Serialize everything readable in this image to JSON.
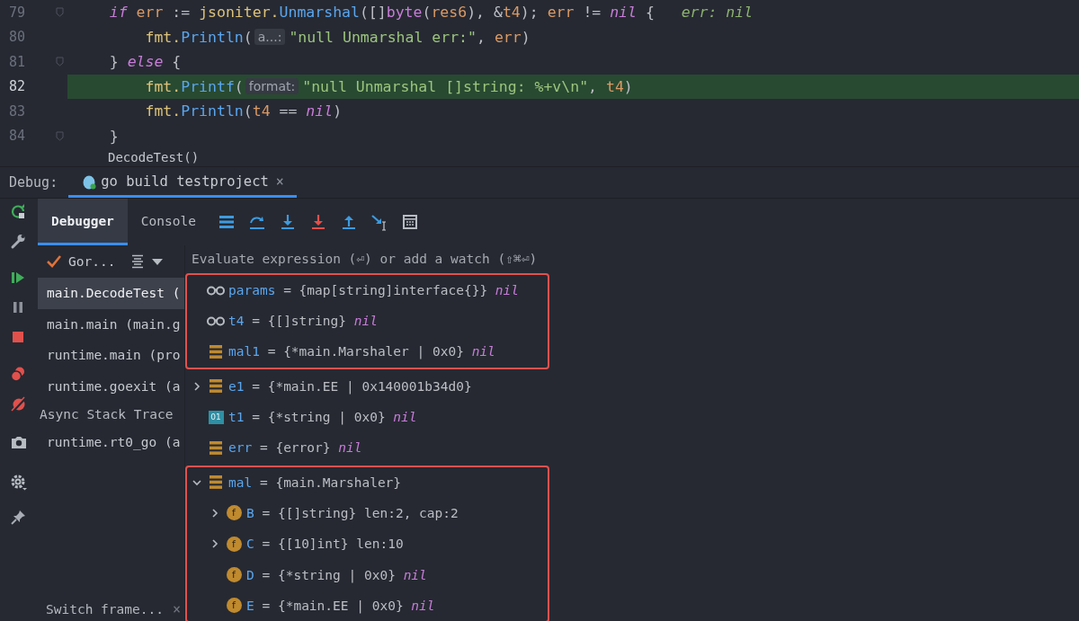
{
  "editor": {
    "lines": [
      {
        "number": "79",
        "current": false,
        "fold": true,
        "tokens": [
          {
            "kind": "kw",
            "text": "    if"
          },
          {
            "kind": "var",
            "text": " err"
          },
          {
            "kind": "plain",
            "text": " := "
          },
          {
            "kind": "pkg",
            "text": "jsoniter."
          },
          {
            "kind": "fn",
            "text": "Unmarshal"
          },
          {
            "kind": "plain",
            "text": "([]"
          },
          {
            "kind": "type",
            "text": "byte"
          },
          {
            "kind": "plain",
            "text": "("
          },
          {
            "kind": "var",
            "text": "res6"
          },
          {
            "kind": "plain",
            "text": "), &"
          },
          {
            "kind": "var",
            "text": "t4"
          },
          {
            "kind": "plain",
            "text": "); "
          },
          {
            "kind": "var",
            "text": "err"
          },
          {
            "kind": "plain",
            "text": " != "
          },
          {
            "kind": "kw",
            "text": "nil"
          },
          {
            "kind": "plain",
            "text": " {   "
          },
          {
            "kind": "hint",
            "text": "err: nil"
          }
        ]
      },
      {
        "number": "80",
        "current": false,
        "fold": false,
        "tokens": [
          {
            "kind": "pkg",
            "text": "        fmt."
          },
          {
            "kind": "fn",
            "text": "Println"
          },
          {
            "kind": "plain",
            "text": "("
          },
          {
            "kind": "inlay",
            "text": "a...:"
          },
          {
            "kind": "str",
            "text": "\"null Unmarshal err:\""
          },
          {
            "kind": "plain",
            "text": ", "
          },
          {
            "kind": "var",
            "text": "err"
          },
          {
            "kind": "plain",
            "text": ")"
          }
        ]
      },
      {
        "number": "81",
        "current": false,
        "fold": true,
        "tokens": [
          {
            "kind": "plain",
            "text": "    }"
          },
          {
            "kind": "kw",
            "text": " else"
          },
          {
            "kind": "plain",
            "text": " {"
          }
        ]
      },
      {
        "number": "82",
        "current": true,
        "fold": false,
        "tokens": [
          {
            "kind": "pkg",
            "text": "        fmt."
          },
          {
            "kind": "fn",
            "text": "Printf"
          },
          {
            "kind": "plain",
            "text": "("
          },
          {
            "kind": "inlay",
            "text": "format:"
          },
          {
            "kind": "str",
            "text": "\"null Unmarshal []string: %+v\\n\""
          },
          {
            "kind": "plain",
            "text": ", "
          },
          {
            "kind": "var",
            "text": "t4"
          },
          {
            "kind": "plain",
            "text": ")"
          }
        ]
      },
      {
        "number": "83",
        "current": false,
        "fold": false,
        "tokens": [
          {
            "kind": "pkg",
            "text": "        fmt."
          },
          {
            "kind": "fn",
            "text": "Println"
          },
          {
            "kind": "plain",
            "text": "("
          },
          {
            "kind": "var",
            "text": "t4"
          },
          {
            "kind": "plain",
            "text": " == "
          },
          {
            "kind": "kw",
            "text": "nil"
          },
          {
            "kind": "plain",
            "text": ")"
          }
        ]
      },
      {
        "number": "84",
        "current": false,
        "fold": true,
        "tokens": [
          {
            "kind": "plain",
            "text": "    }"
          }
        ]
      }
    ],
    "breadcrumb": "DecodeTest()"
  },
  "debug_bar": {
    "label": "Debug:",
    "tab": {
      "title": "go build testproject",
      "close": "×",
      "selected": true
    }
  },
  "side_toolbar": [
    {
      "kind": "rerun"
    },
    {
      "kind": "wrench"
    },
    {
      "kind": "resume"
    },
    {
      "kind": "pause"
    },
    {
      "kind": "stop"
    },
    {
      "kind": "breakpoints"
    },
    {
      "kind": "mute"
    },
    {
      "kind": "camera"
    },
    {
      "kind": "gear"
    },
    {
      "kind": "pin"
    }
  ],
  "tabs": [
    {
      "label": "Debugger",
      "selected": true
    },
    {
      "label": "Console",
      "selected": false
    }
  ],
  "toolbar": [
    {
      "kind": "list"
    },
    {
      "kind": "step-over"
    },
    {
      "kind": "step-into"
    },
    {
      "kind": "force-step"
    },
    {
      "kind": "step-out"
    },
    {
      "kind": "run-cursor"
    },
    {
      "kind": "calculator"
    }
  ],
  "frames": {
    "thread": "Gor...",
    "items": [
      {
        "kind": "frame",
        "text": "main.DecodeTest (",
        "selected": true
      },
      {
        "kind": "frame",
        "text": "main.main (main.g",
        "selected": false
      },
      {
        "kind": "frame",
        "text": "runtime.main (pro",
        "selected": false
      },
      {
        "kind": "frame",
        "text": "runtime.goexit (a",
        "selected": false
      },
      {
        "kind": "header",
        "text": "Async Stack Trace"
      },
      {
        "kind": "frame",
        "text": "runtime.rt0_go (a",
        "selected": false
      }
    ],
    "switch_frame": {
      "text": "Switch frame...",
      "close": "×"
    }
  },
  "variables": {
    "placeholder": "Evaluate expression (⏎) or add a watch (⇧⌘⏎)",
    "groups": [
      {
        "outlined": true,
        "items": [
          {
            "kind": "watch",
            "name": "params",
            "op": "=",
            "type": "{map[string]interface{}}",
            "keyword": "nil"
          },
          {
            "kind": "watch",
            "name": "t4",
            "op": "=",
            "type": "{[]string}",
            "keyword": "nil"
          },
          {
            "kind": "struct",
            "name": "mal1",
            "op": "=",
            "type": "{*main.Marshaler | 0x0}",
            "keyword": "nil"
          }
        ]
      },
      {
        "outlined": false,
        "items": [
          {
            "kind": "struct",
            "name": "e1",
            "op": "=",
            "type": "{*main.EE | 0x140001b34d0}",
            "expanded": false
          },
          {
            "kind": "pointer",
            "badge": "01",
            "name": "t1",
            "op": "=",
            "type": "{*string | 0x0}",
            "keyword": "nil"
          },
          {
            "kind": "struct",
            "name": "err",
            "op": "=",
            "type": "{error}",
            "keyword": "nil"
          }
        ]
      },
      {
        "outlined": true,
        "items": [
          {
            "kind": "struct",
            "name": "mal",
            "op": "=",
            "type": "{main.Marshaler}",
            "expanded": true,
            "children": [
              {
                "kind": "field",
                "badge": "f",
                "name": "B",
                "op": "=",
                "type": "{[]string}",
                "value": "len:2, cap:2",
                "expanded": false
              },
              {
                "kind": "field",
                "badge": "f",
                "name": "C",
                "op": "=",
                "type": "{[10]int}",
                "value": "len:10",
                "expanded": false
              },
              {
                "kind": "field",
                "badge": "f",
                "name": "D",
                "op": "=",
                "type": "{*string | 0x0}",
                "keyword": "nil"
              },
              {
                "kind": "field",
                "badge": "f",
                "name": "E",
                "op": "=",
                "type": "{*main.EE | 0x0}",
                "keyword": "nil"
              }
            ]
          }
        ]
      }
    ]
  }
}
